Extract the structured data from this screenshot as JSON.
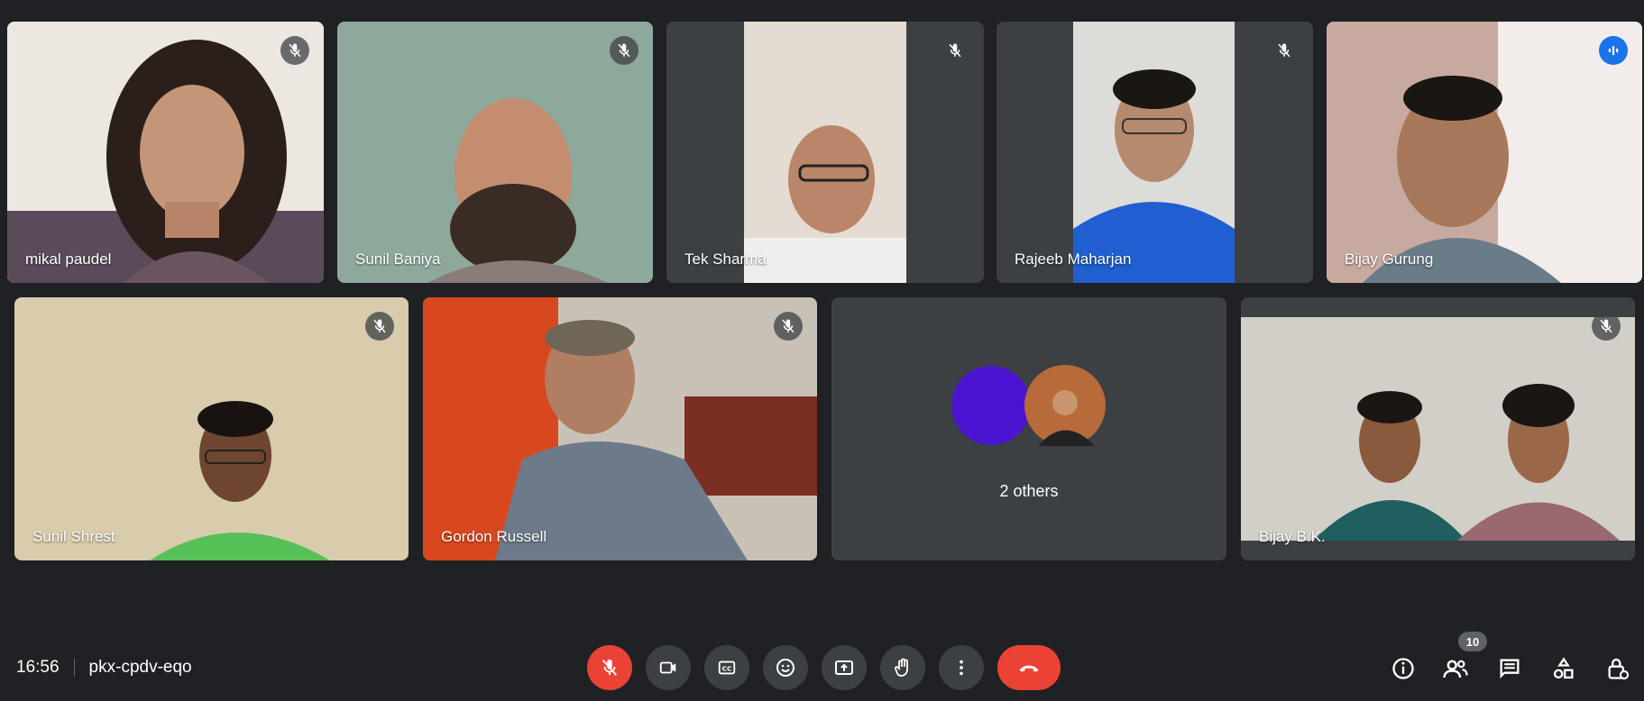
{
  "participants": [
    {
      "name": "mikal paudel",
      "status": "muted"
    },
    {
      "name": "Sunil Baniya",
      "status": "muted"
    },
    {
      "name": "Tek Sharma",
      "status": "muted"
    },
    {
      "name": "Rajeeb Maharjan",
      "status": "muted"
    },
    {
      "name": "Bijay Gurung",
      "status": "speaking"
    },
    {
      "name": "Sunil Shrest",
      "status": "muted"
    },
    {
      "name": "Gordon Russell",
      "status": "muted"
    },
    {
      "name": "Bijay B.K.",
      "status": "muted"
    }
  ],
  "others": {
    "label": "2 others",
    "avatar_color": "#4a14d0"
  },
  "meeting": {
    "time": "16:56",
    "code": "pkx-cpdv-eqo"
  },
  "people_count": "10",
  "colors": {
    "background": "#202124",
    "tile": "#3c4043",
    "accent": "#1a73e8",
    "danger": "#ea4335"
  },
  "controls": [
    "mic-off-icon",
    "camera-icon",
    "captions-icon",
    "emoji-icon",
    "present-icon",
    "raise-hand-icon",
    "more-options-icon",
    "end-call-icon"
  ],
  "side_controls": [
    "info-icon",
    "people-icon",
    "chat-icon",
    "activities-icon",
    "host-controls-icon"
  ]
}
